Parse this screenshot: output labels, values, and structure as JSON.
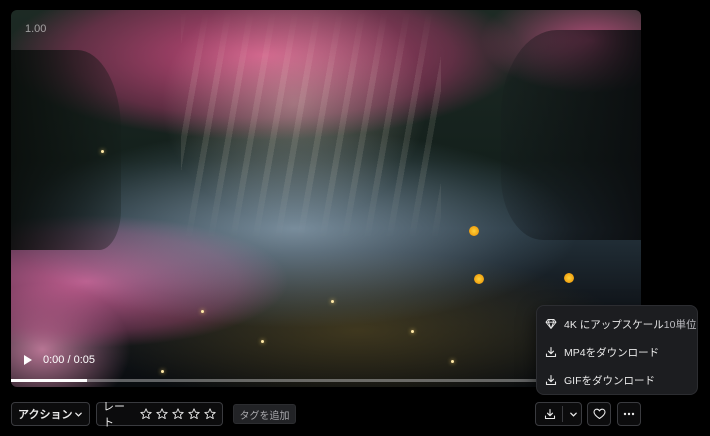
{
  "player": {
    "speed": "1.00",
    "time": "0:00 / 0:05",
    "progress": 0.12
  },
  "download_menu": {
    "items": [
      {
        "icon": "diamond-icon",
        "label": "4K にアップスケール",
        "suffix": "10単位"
      },
      {
        "icon": "download-icon",
        "label": "MP4をダウンロード"
      },
      {
        "icon": "download-icon",
        "label": "GIFをダウンロード"
      }
    ]
  },
  "toolbar": {
    "action_label": "アクション",
    "rate_label": "レート",
    "stars": 5,
    "rating": 0,
    "tag_label": "タグを追加"
  },
  "colors": {
    "background": "#000000",
    "menu_background": "#1c1d20",
    "button_border": "#3a3b3f"
  }
}
